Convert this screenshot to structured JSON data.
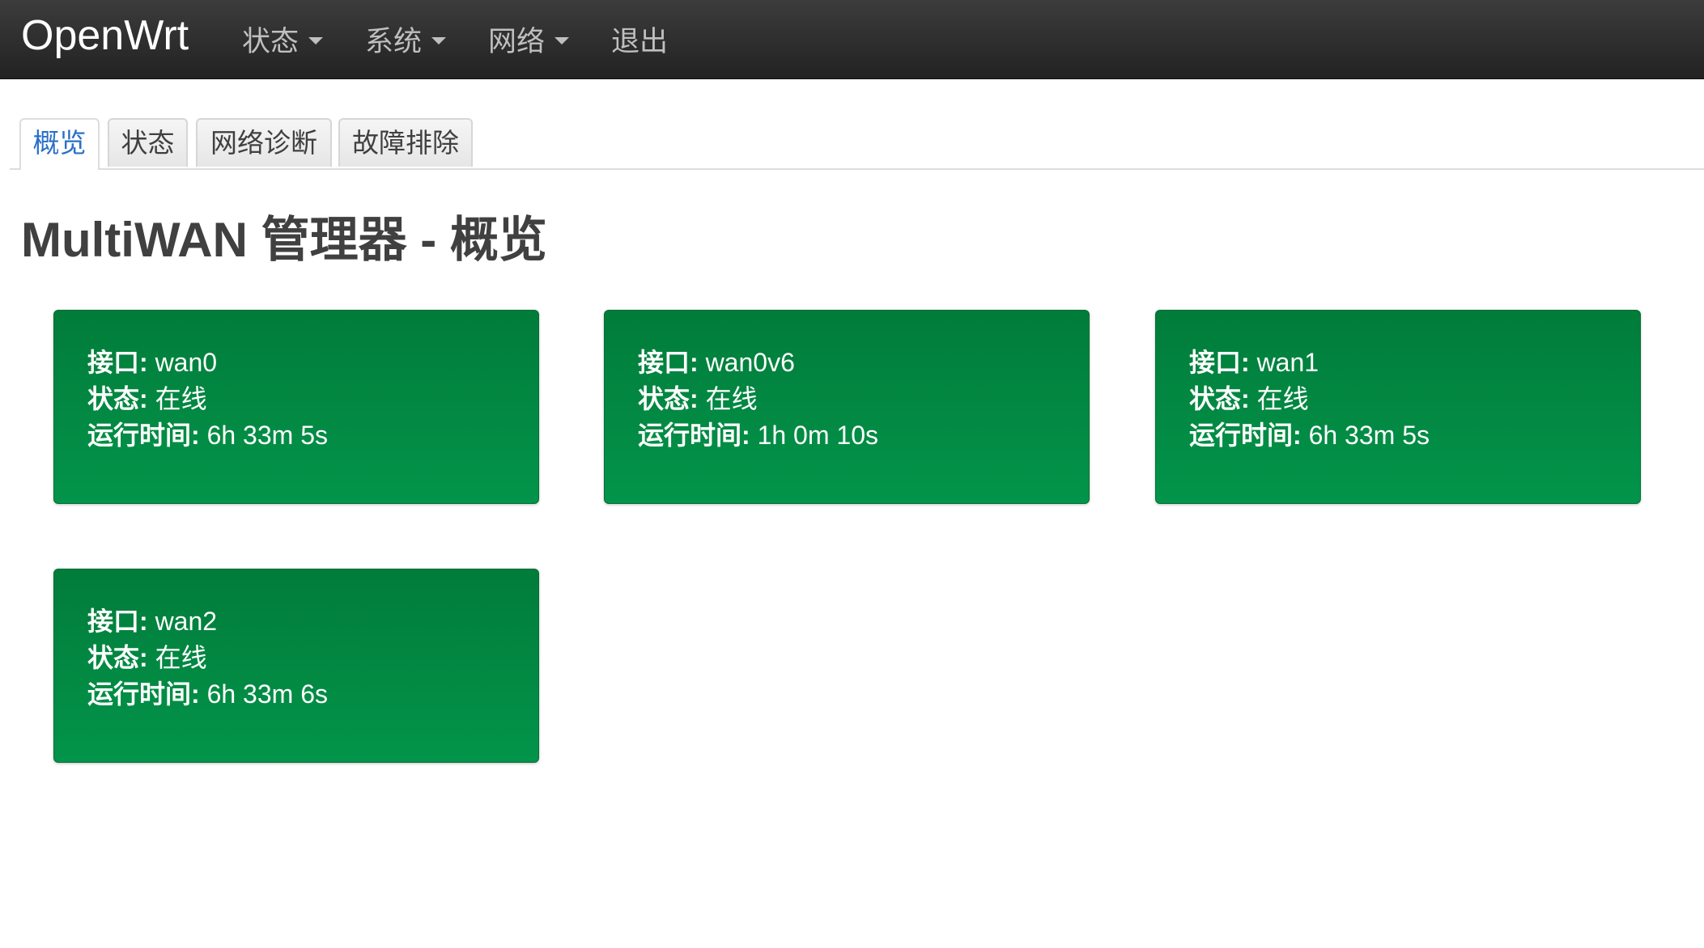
{
  "navbar": {
    "brand": "OpenWrt",
    "menu": [
      {
        "label": "状态",
        "has_caret": true
      },
      {
        "label": "系统",
        "has_caret": true
      },
      {
        "label": "网络",
        "has_caret": true
      },
      {
        "label": "退出",
        "has_caret": false
      }
    ]
  },
  "tabs": [
    {
      "label": "概览",
      "active": true
    },
    {
      "label": "状态",
      "active": false
    },
    {
      "label": "网络诊断",
      "active": false
    },
    {
      "label": "故障排除",
      "active": false
    }
  ],
  "page_title": "MultiWAN 管理器 - 概览",
  "labels": {
    "interface": "接口:",
    "status": "状态:",
    "uptime": "运行时间:"
  },
  "interfaces": [
    {
      "name": "wan0",
      "status": "在线",
      "uptime": "6h 33m 5s"
    },
    {
      "name": "wan0v6",
      "status": "在线",
      "uptime": "1h 0m 10s"
    },
    {
      "name": "wan1",
      "status": "在线",
      "uptime": "6h 33m 5s"
    },
    {
      "name": "wan2",
      "status": "在线",
      "uptime": "6h 33m 6s"
    }
  ],
  "colors": {
    "navbar": "#222222",
    "card_online": "#02944a",
    "tab_active_text": "#2a70c6"
  }
}
